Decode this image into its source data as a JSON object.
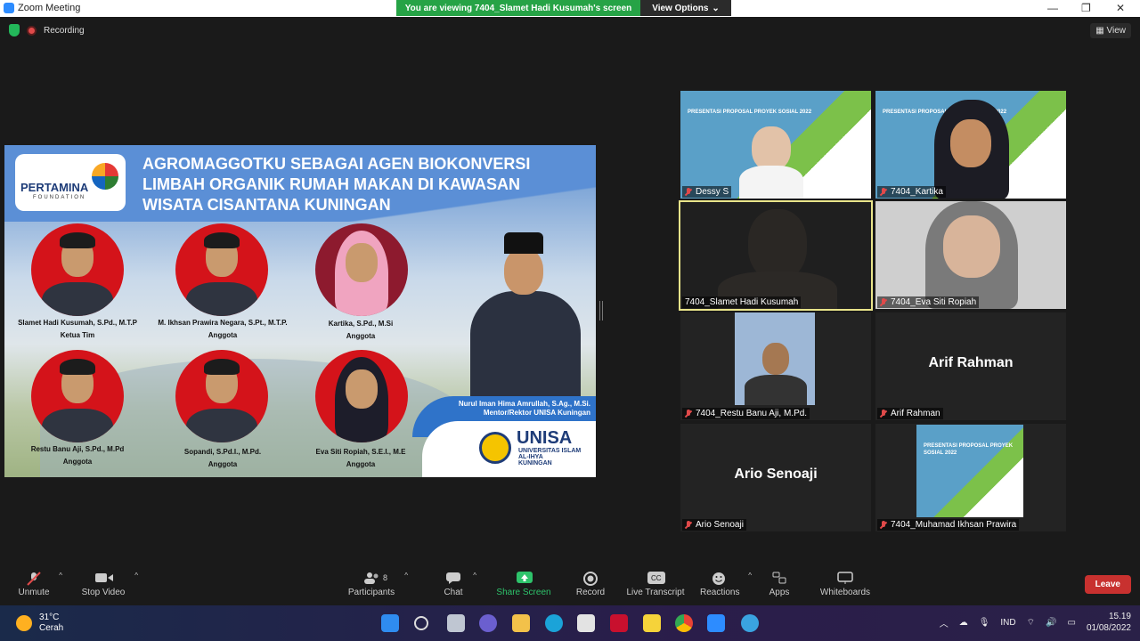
{
  "window": {
    "title": "Zoom Meeting",
    "minimize": "—",
    "maximize": "❐",
    "close": "✕"
  },
  "banner": {
    "viewing": "You are viewing 7404_Slamet Hadi Kusumah's screen",
    "view_options": "View Options"
  },
  "status": {
    "recording": "Recording",
    "view_button": "View"
  },
  "slide": {
    "logo_text": "PERTAMINA",
    "logo_sub": "FOUNDATION",
    "title": "AGROMAGGOTKU SEBAGAI AGEN BIOKONVERSI LIMBAH ORGANIK RUMAH MAKAN DI KAWASAN WISATA CISANTANA KUNINGAN",
    "members": [
      {
        "name": "Slamet Hadi Kusumah, S.Pd., M.T.P",
        "role": "Ketua Tim"
      },
      {
        "name": "M. Ikhsan Prawira Negara, S.Pt., M.T.P.",
        "role": "Anggota"
      },
      {
        "name": "Kartika, S.Pd., M.Si",
        "role": "Anggota"
      },
      {
        "name": "Restu Banu Aji, S.Pd., M.Pd",
        "role": "Anggota"
      },
      {
        "name": "Sopandi, S.Pd.I., M.Pd.",
        "role": "Anggota"
      },
      {
        "name": "Eva Siti Ropiah, S.E.I., M.E",
        "role": "Anggota"
      }
    ],
    "mentor_name": "Nurul Iman Hima Amrullah, S.Ag., M.Si.",
    "mentor_role": "Mentor/Rektor UNISA Kuningan",
    "unisa_name": "UNISA",
    "unisa_sub1": "UNIVERSITAS ISLAM",
    "unisa_sub2": "AL-IHYA",
    "unisa_sub3": "KUNINGAN"
  },
  "thumb_slide_text": "PRESENTASI PROPOSAL PROYEK SOSIAL 2022",
  "participants_tiles": [
    {
      "name": "Dessy S"
    },
    {
      "name": "7404_Kartika"
    },
    {
      "name": "7404_Slamet Hadi Kusumah"
    },
    {
      "name": "7404_Eva Siti Ropiah"
    },
    {
      "name": "7404_Restu Banu Aji, M.Pd."
    },
    {
      "name": "Arif Rahman",
      "big": "Arif Rahman"
    },
    {
      "name": "Ario Senoaji",
      "big": "Ario Senoaji"
    },
    {
      "name": "7404_Muhamad Ikhsan Prawira"
    }
  ],
  "toolbar": {
    "unmute": "Unmute",
    "stop_video": "Stop Video",
    "participants": "Participants",
    "participant_count": "8",
    "chat": "Chat",
    "share_screen": "Share Screen",
    "record": "Record",
    "live_transcript": "Live Transcript",
    "reactions": "Reactions",
    "apps": "Apps",
    "whiteboards": "Whiteboards",
    "leave": "Leave"
  },
  "taskbar": {
    "temp": "31°C",
    "weather": "Cerah",
    "lang": "IND",
    "time": "15.19",
    "date": "01/08/2022"
  },
  "colors": {
    "share_green": "#26a346",
    "leave_red": "#c8312f",
    "active_border": "#e9e48a"
  }
}
